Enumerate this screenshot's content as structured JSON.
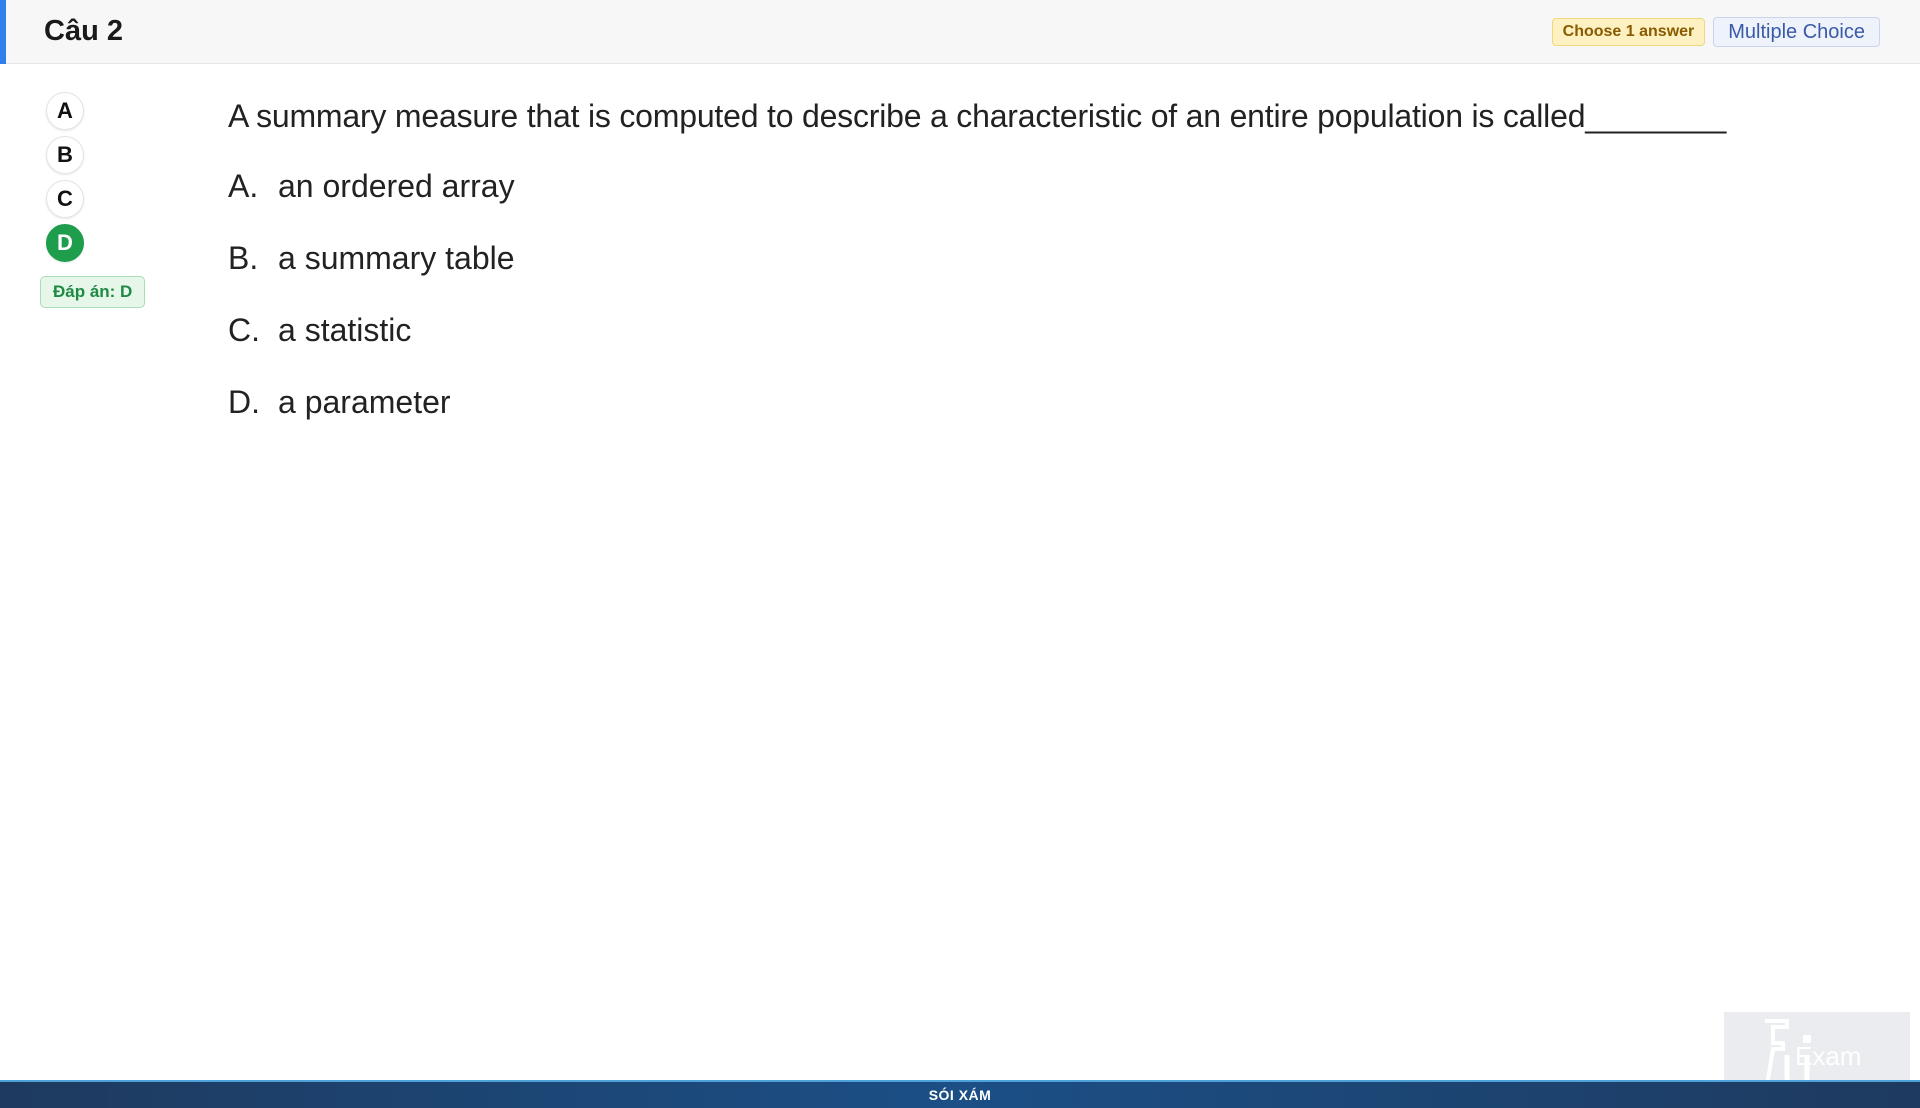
{
  "header": {
    "title": "Câu 2",
    "badge_choose": "Choose 1 answer",
    "badge_type": "Multiple Choice"
  },
  "answer_selector": {
    "options": [
      "A",
      "B",
      "C",
      "D"
    ],
    "selected": "D",
    "answer_label": "Đáp án: D"
  },
  "question": {
    "text": "A summary measure that is computed to describe a characteristic of an entire population is called________",
    "options": [
      {
        "letter": "A.",
        "text": "an ordered array"
      },
      {
        "letter": "B.",
        "text": "a summary table"
      },
      {
        "letter": "C.",
        "text": "a statistic"
      },
      {
        "letter": "D.",
        "text": "a parameter"
      }
    ]
  },
  "footer": {
    "text": "SÓI XÁM"
  },
  "logo": {
    "icon": "fu-exam-logo",
    "text": "Exam"
  },
  "colors": {
    "accent": "#2f80ed",
    "correct": "#1e9e4d",
    "footer_bg": "#1b4f86"
  }
}
